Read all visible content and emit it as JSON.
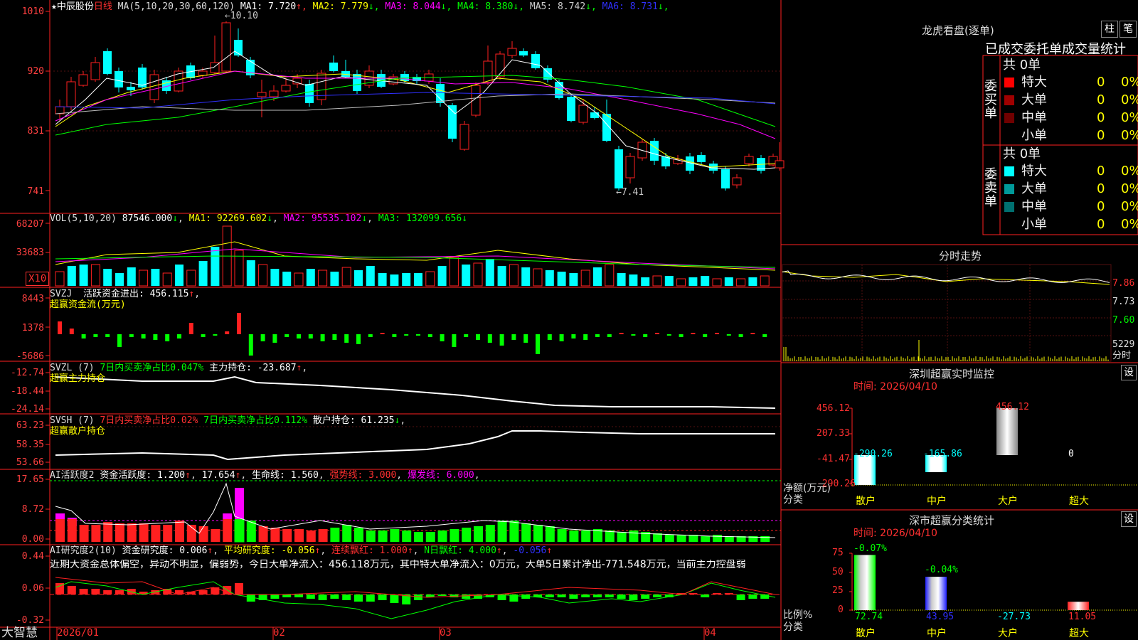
{
  "header": {
    "stock_name": "★中辰股份",
    "period": "日线",
    "ma_label": "MA(5,10,20,30,60,120)",
    "ma_values": [
      {
        "label": "MA1:",
        "value": "7.720",
        "arrow": "↑",
        "color": "#ffffff"
      },
      {
        "label": "MA2:",
        "value": "7.779",
        "arrow": "↓",
        "color": "#ffff00"
      },
      {
        "label": "MA3:",
        "value": "8.044",
        "arrow": "↓",
        "color": "#ff00ff"
      },
      {
        "label": "MA4:",
        "value": "8.380",
        "arrow": "↓",
        "color": "#00ff00"
      },
      {
        "label": "MA5:",
        "value": "8.742",
        "arrow": "↓",
        "color": "#cccccc"
      },
      {
        "label": "MA6:",
        "value": "8.731",
        "arrow": "↓",
        "color": "#3030ff"
      }
    ],
    "high_mark": "10.10",
    "low_mark": "7.41"
  },
  "price_axis": [
    "1010",
    "920",
    "831",
    "741"
  ],
  "vol_panel": {
    "label": "VOL(5,10,20)",
    "value": "87546.000",
    "ma1": "MA1: 92269.602",
    "ma2": "MA2: 95535.102",
    "ma3": "MA3: 132099.656",
    "axis": [
      "68207",
      "33683"
    ],
    "unit_badge": "X10"
  },
  "svzj_panel": {
    "label": "SVZJ",
    "text": "活跃资金进出: 456.115",
    "subtitle": "超赢资金流(万元)",
    "axis": [
      "8443",
      "1378",
      "-5686"
    ]
  },
  "svzl_panel": {
    "label": "SVZL (7)",
    "text1": "7日内买卖净占比0.047%",
    "text2": "主力持仓: -23.687",
    "subtitle": "超赢主力持仓",
    "axis": [
      "-12.74",
      "-18.44",
      "-24.14"
    ]
  },
  "svsh_panel": {
    "label": "SVSH (7)",
    "text1": "7日内买卖净占比0.02%",
    "text2": "7日内买卖净占比0.112%",
    "text3": "散户持仓: 61.235",
    "subtitle": "超赢散户持仓",
    "axis": [
      "63.23",
      "58.35",
      "53.66"
    ]
  },
  "ai_active_panel": {
    "label": "AI活跃度2",
    "text1": "资金活跃度: 1.200",
    "text2": "17.654",
    "text3": "生命线: 1.560",
    "text4": "强势线: 3.000",
    "text5": "爆发线: 6.000",
    "axis": [
      "17.65",
      "8.72",
      "0.00"
    ]
  },
  "ai_research_panel": {
    "label": "AI研究度2(10)",
    "text1": "资金研究度: 0.006",
    "text2": "平均研究度: -0.056",
    "text3": "连续飘红: 1.000",
    "text4": "N日飘红: 4.000",
    "text5": "-0.056",
    "summary": "近期大资金总体偏空，异动不明显，偏弱势，今日大单净流入：456.118万元，其中特大单净流入：0万元，大单5日累计净出-771.548万元，当前主力控盘弱",
    "axis": [
      "0.44",
      "0.06",
      "-0.32"
    ]
  },
  "date_axis": {
    "brand": "大智慧",
    "labels": [
      "2026/01",
      "02",
      "03",
      "04"
    ]
  },
  "dragon_tiger": {
    "title": "龙虎看盘(逐单)",
    "tab1": "柱",
    "tab2": "笔",
    "header": "已成交委托单成交量统计",
    "buy_label": "委买单",
    "sell_label": "委卖单",
    "buy_count": "共 0单",
    "sell_count": "共 0单",
    "buy_rows": [
      {
        "name": "特大",
        "qty": "0",
        "pct": "0%",
        "color": "#ff0000"
      },
      {
        "name": "大单",
        "qty": "0",
        "pct": "0%",
        "color": "#a00000"
      },
      {
        "name": "中单",
        "qty": "0",
        "pct": "0%",
        "color": "#700000"
      },
      {
        "name": "小单",
        "qty": "0",
        "pct": "0%",
        "color": ""
      }
    ],
    "sell_rows": [
      {
        "name": "特大",
        "qty": "0",
        "pct": "0%",
        "color": "#00ffff"
      },
      {
        "name": "大单",
        "qty": "0",
        "pct": "0%",
        "color": "#009a9a"
      },
      {
        "name": "中单",
        "qty": "0",
        "pct": "0%",
        "color": "#007070"
      },
      {
        "name": "小单",
        "qty": "0",
        "pct": "0%",
        "color": ""
      }
    ]
  },
  "intraday": {
    "title": "分时走势",
    "axis": [
      "7.86",
      "7.73",
      "7.60"
    ],
    "vol_axis": "5229",
    "vol_unit": "分时"
  },
  "realtime_monitor": {
    "title": "深圳超赢实时监控",
    "settings": "设",
    "time": "时间: 2026/04/10",
    "y_axis": [
      "456.12",
      "207.33",
      "-41.47",
      "-290.26"
    ],
    "y_label": "净额(万元)",
    "x_label": "分类",
    "categories": [
      "散户",
      "中户",
      "大户",
      "超大"
    ],
    "values": [
      -290.26,
      -165.86,
      456.12,
      0
    ],
    "value_labels": [
      "-290.26",
      "-165.86",
      "456.12",
      "0"
    ]
  },
  "class_stats": {
    "title": "深市超赢分类统计",
    "settings": "设",
    "time": "时间: 2026/04/10",
    "y_axis": [
      "75",
      "50",
      "25",
      "0"
    ],
    "y_label": "比例%",
    "x_label": "分类",
    "categories": [
      "散户",
      "中户",
      "大户",
      "超大"
    ],
    "top_labels": [
      "-0.07%",
      "-0.04%",
      "",
      ""
    ],
    "values": [
      72.74,
      43.95,
      -27.73,
      11.05
    ],
    "value_labels": [
      "72.74",
      "43.95",
      "-27.73",
      "11.05"
    ]
  }
}
